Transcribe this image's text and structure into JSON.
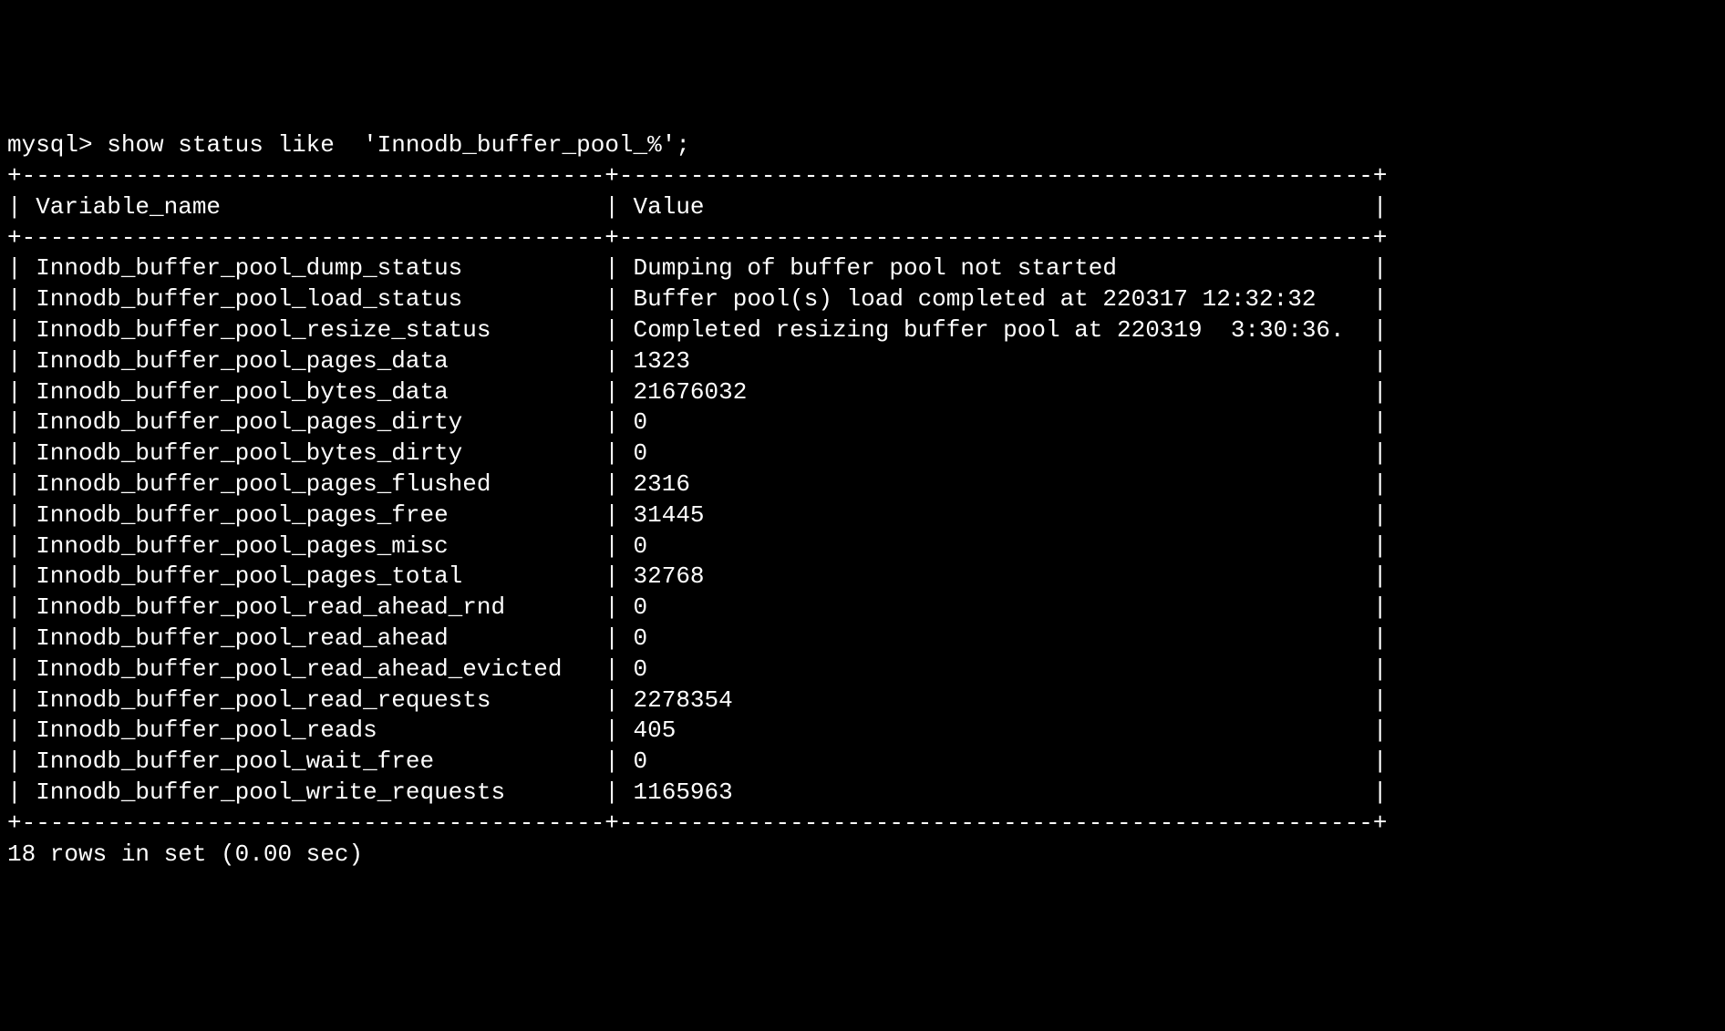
{
  "prompt": "mysql>",
  "command": "show status like  'Innodb_buffer_pool_%';",
  "headers": {
    "col1": "Variable_name",
    "col2": "Value"
  },
  "rows": [
    {
      "name": "Innodb_buffer_pool_dump_status",
      "value": "Dumping of buffer pool not started"
    },
    {
      "name": "Innodb_buffer_pool_load_status",
      "value": "Buffer pool(s) load completed at 220317 12:32:32"
    },
    {
      "name": "Innodb_buffer_pool_resize_status",
      "value": "Completed resizing buffer pool at 220319  3:30:36."
    },
    {
      "name": "Innodb_buffer_pool_pages_data",
      "value": "1323"
    },
    {
      "name": "Innodb_buffer_pool_bytes_data",
      "value": "21676032"
    },
    {
      "name": "Innodb_buffer_pool_pages_dirty",
      "value": "0"
    },
    {
      "name": "Innodb_buffer_pool_bytes_dirty",
      "value": "0"
    },
    {
      "name": "Innodb_buffer_pool_pages_flushed",
      "value": "2316"
    },
    {
      "name": "Innodb_buffer_pool_pages_free",
      "value": "31445"
    },
    {
      "name": "Innodb_buffer_pool_pages_misc",
      "value": "0"
    },
    {
      "name": "Innodb_buffer_pool_pages_total",
      "value": "32768"
    },
    {
      "name": "Innodb_buffer_pool_read_ahead_rnd",
      "value": "0"
    },
    {
      "name": "Innodb_buffer_pool_read_ahead",
      "value": "0"
    },
    {
      "name": "Innodb_buffer_pool_read_ahead_evicted",
      "value": "0"
    },
    {
      "name": "Innodb_buffer_pool_read_requests",
      "value": "2278354"
    },
    {
      "name": "Innodb_buffer_pool_reads",
      "value": "405"
    },
    {
      "name": "Innodb_buffer_pool_wait_free",
      "value": "0"
    },
    {
      "name": "Innodb_buffer_pool_write_requests",
      "value": "1165963"
    }
  ],
  "footer": "18 rows in set (0.00 sec)",
  "col1_width": 39,
  "col2_width": 51
}
